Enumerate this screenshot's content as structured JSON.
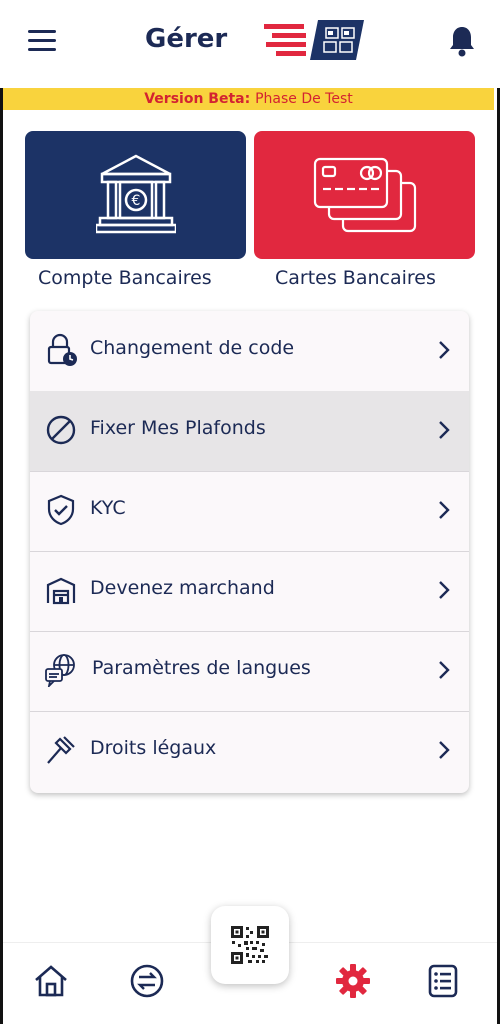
{
  "header": {
    "title": "Gérer"
  },
  "beta_banner": {
    "label": "Version Beta:",
    "text": "Phase De Test"
  },
  "tiles": [
    {
      "label": "Compte Bancaires",
      "icon": "bank-icon"
    },
    {
      "label": "Cartes Bancaires",
      "icon": "cards-icon"
    }
  ],
  "menu": [
    {
      "label": "Changement de code",
      "icon": "lock-clock-icon"
    },
    {
      "label": "Fixer Mes Plafonds",
      "icon": "block-icon"
    },
    {
      "label": "KYC",
      "icon": "shield-check-icon"
    },
    {
      "label": "Devenez marchand",
      "icon": "store-icon"
    },
    {
      "label": "Paramètres de langues",
      "icon": "language-icon"
    },
    {
      "label": "Droits légaux",
      "icon": "gavel-icon"
    }
  ],
  "bottom_nav": [
    {
      "name": "home",
      "icon": "home-icon"
    },
    {
      "name": "transfer",
      "icon": "transfer-icon"
    },
    {
      "name": "qr",
      "icon": "qr-code-icon"
    },
    {
      "name": "settings",
      "icon": "gear-icon",
      "active": true
    },
    {
      "name": "history",
      "icon": "list-icon"
    }
  ],
  "colors": {
    "navy": "#1c3366",
    "red": "#e1283f",
    "yellow": "#f9d33d",
    "text": "#1c2a55"
  }
}
